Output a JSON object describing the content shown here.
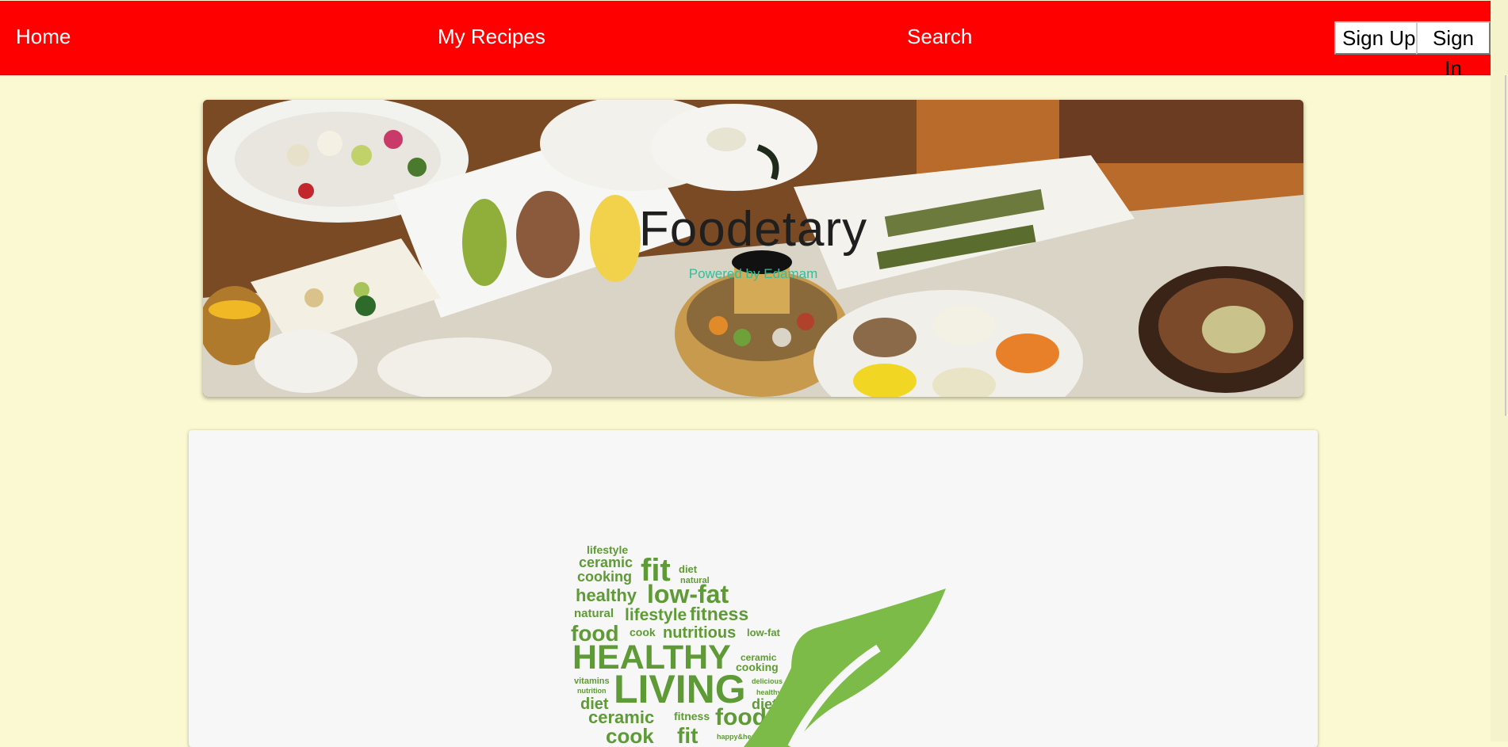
{
  "nav": {
    "home": "Home",
    "my_recipes": "My Recipes",
    "search": "Search",
    "sign_up": "Sign Up",
    "sign_in": "Sign In"
  },
  "hero": {
    "title": "Foodetary",
    "subtitle": "Powered by Edamam"
  },
  "healthy_living_graphic": {
    "words": [
      "lifestyle",
      "ceramic",
      "cooking",
      "fit",
      "diet",
      "natural",
      "healthy",
      "low-fat",
      "natural",
      "lifestyle",
      "fitness",
      "food",
      "cook",
      "nutritious",
      "low-fat",
      "HEALTHY",
      "ceramic",
      "cooking",
      "vitamins",
      "nutrition",
      "LIVING",
      "delicious",
      "healthy",
      "diet",
      "diet",
      "ceramic",
      "fitness",
      "food",
      "cook",
      "fit",
      "happy&healthy"
    ]
  },
  "colors": {
    "navbar": "#ff0000",
    "page_background": "#fbf9d1",
    "card_background": "#f7f7f7",
    "leaf_green": "#7dbb48",
    "subtitle_teal": "#2fbf9a"
  }
}
